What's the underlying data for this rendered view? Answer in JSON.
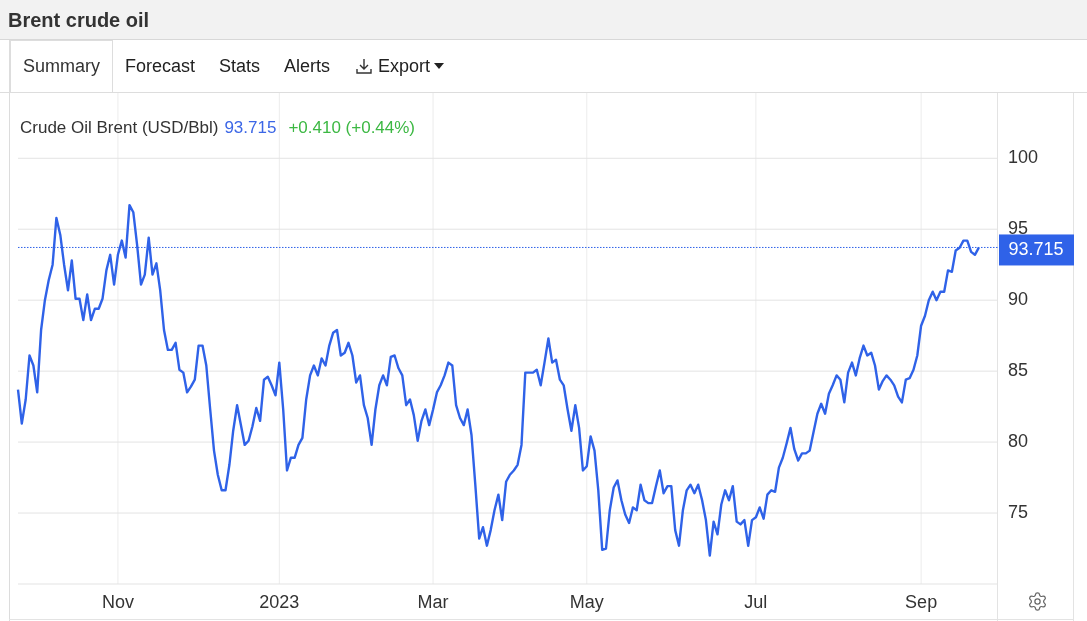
{
  "title": "Brent crude oil",
  "tabs": [
    {
      "label": "Summary",
      "kind": "tab",
      "selected": true
    },
    {
      "label": "Forecast",
      "kind": "tab",
      "selected": false
    },
    {
      "label": "Stats",
      "kind": "tab",
      "selected": false
    },
    {
      "label": "Alerts",
      "kind": "tab",
      "selected": false
    },
    {
      "label": "Export",
      "kind": "menu",
      "selected": false
    }
  ],
  "legend": {
    "price": "93.715",
    "change": "+0.410 (+0.44%)"
  },
  "chart": {
    "chart_data": {
      "type": "line",
      "categories": [
        null,
        null,
        null,
        null,
        null,
        null,
        null,
        null,
        null,
        null,
        null,
        null,
        null,
        null,
        null,
        null,
        null,
        null,
        null,
        null,
        null,
        null,
        null,
        null,
        null,
        null,
        "Nov",
        null,
        null,
        null,
        null,
        null,
        null,
        null,
        null,
        null,
        null,
        null,
        null,
        null,
        null,
        null,
        null,
        null,
        null,
        null,
        null,
        null,
        null,
        null,
        null,
        null,
        null,
        null,
        null,
        null,
        null,
        null,
        null,
        null,
        null,
        null,
        null,
        null,
        null,
        null,
        null,
        null,
        "2023",
        null,
        null,
        null,
        null,
        null,
        null,
        null,
        null,
        null,
        null,
        null,
        null,
        null,
        null,
        null,
        null,
        null,
        null,
        null,
        null,
        null,
        null,
        null,
        null,
        null,
        null,
        null,
        null,
        null,
        null,
        null,
        null,
        null,
        null,
        null,
        null,
        null,
        null,
        null,
        "Mar",
        null,
        null,
        null,
        null,
        null,
        null,
        null,
        null,
        null,
        null,
        null,
        null,
        null,
        null,
        null,
        null,
        null,
        null,
        null,
        null,
        null,
        null,
        null,
        null,
        null,
        null,
        null,
        null,
        null,
        null,
        null,
        null,
        null,
        null,
        null,
        null,
        null,
        null,
        null,
        "May",
        null,
        null,
        null,
        null,
        null,
        null,
        null,
        null,
        null,
        null,
        null,
        null,
        null,
        null,
        null,
        null,
        null,
        null,
        null,
        null,
        null,
        null,
        null,
        null,
        null,
        null,
        null,
        null,
        null,
        null,
        null,
        null,
        null,
        null,
        null,
        null,
        null,
        null,
        null,
        null,
        null,
        null,
        null,
        "Jul",
        null,
        null,
        null,
        null,
        null,
        null,
        null,
        null,
        null,
        null,
        null,
        null,
        null,
        null,
        null,
        null,
        null,
        null,
        null,
        null,
        null,
        null,
        null,
        null,
        null,
        null,
        null,
        null,
        null,
        null,
        null,
        null,
        null,
        null,
        null,
        null,
        null,
        null,
        null,
        null,
        null,
        null,
        "Sep",
        null,
        null,
        null,
        null,
        null,
        null,
        null,
        null,
        null,
        null,
        null,
        null,
        null,
        null,
        null
      ],
      "series": [
        {
          "name": "Crude Oil Brent (USD/Bbl)",
          "color": "#2f62e8",
          "values": [
            83.7,
            81.3,
            83.0,
            86.1,
            85.4,
            83.5,
            87.9,
            90.0,
            91.4,
            92.5,
            95.8,
            94.6,
            92.5,
            90.7,
            92.8,
            90.1,
            90.1,
            88.6,
            90.4,
            88.6,
            89.4,
            89.4,
            90.1,
            92.1,
            93.2,
            91.1,
            93.2,
            94.2,
            93.0,
            96.7,
            96.2,
            93.9,
            91.1,
            91.8,
            94.4,
            91.8,
            92.6,
            90.7,
            87.9,
            86.5,
            86.5,
            87.0,
            85.1,
            84.9,
            83.5,
            83.9,
            84.4,
            86.8,
            86.8,
            85.4,
            82.3,
            79.4,
            77.7,
            76.6,
            76.6,
            78.4,
            80.8,
            82.6,
            81.2,
            79.8,
            80.1,
            81.1,
            82.4,
            81.5,
            84.4,
            84.6,
            84.0,
            83.3,
            85.6,
            82.3,
            78.0,
            78.9,
            78.9,
            79.8,
            80.3,
            83.0,
            84.7,
            85.4,
            84.7,
            85.9,
            85.4,
            86.8,
            87.7,
            87.9,
            86.1,
            86.3,
            87.0,
            86.1,
            84.2,
            84.7,
            82.6,
            81.7,
            79.8,
            82.3,
            84.0,
            84.7,
            84.0,
            86.0,
            86.1,
            85.2,
            84.7,
            82.6,
            83.0,
            81.9,
            80.1,
            81.5,
            82.3,
            81.2,
            82.3,
            83.5,
            84.0,
            84.7,
            85.6,
            85.4,
            82.6,
            81.7,
            81.2,
            82.3,
            80.5,
            77.0,
            73.2,
            74.0,
            72.7,
            73.8,
            75.2,
            76.3,
            74.5,
            77.2,
            77.7,
            78.0,
            78.4,
            79.8,
            84.9,
            84.9,
            84.9,
            85.1,
            84.0,
            85.6,
            87.3,
            85.6,
            85.8,
            84.4,
            84.0,
            82.3,
            80.8,
            82.6,
            81.0,
            78.0,
            78.3,
            80.4,
            79.4,
            76.6,
            72.4,
            72.5,
            75.2,
            76.8,
            77.3,
            75.9,
            74.9,
            74.3,
            75.4,
            75.2,
            77.0,
            75.9,
            75.7,
            75.7,
            76.9,
            78.0,
            76.4,
            76.9,
            76.9,
            73.8,
            72.7,
            75.2,
            76.6,
            77.0,
            76.4,
            77.0,
            75.9,
            74.5,
            72.0,
            74.4,
            73.5,
            75.6,
            76.6,
            75.9,
            76.9,
            74.4,
            74.2,
            74.5,
            72.7,
            74.5,
            74.7,
            75.4,
            74.6,
            76.3,
            76.6,
            76.5,
            78.2,
            78.9,
            79.9,
            81.0,
            79.5,
            78.7,
            79.2,
            79.2,
            79.4,
            80.7,
            82.0,
            82.7,
            82.0,
            83.4,
            84.0,
            84.7,
            84.4,
            82.8,
            84.9,
            85.6,
            84.7,
            85.9,
            86.8,
            86.1,
            86.3,
            85.4,
            83.7,
            84.3,
            84.7,
            84.4,
            84.0,
            83.2,
            82.8,
            84.4,
            84.5,
            85.1,
            86.1,
            88.2,
            88.9,
            90.0,
            90.6,
            90.0,
            90.6,
            90.6,
            92.1,
            92.0,
            93.5,
            93.7,
            94.2,
            94.2,
            93.4,
            93.2,
            93.7
          ]
        }
      ],
      "ylim": [
        70,
        104.6
      ],
      "yticks": [
        75,
        80,
        85,
        90,
        95,
        100
      ],
      "grid": true,
      "ref_lines": [
        {
          "axis": "y",
          "value": 93.715,
          "label": "93.715"
        }
      ]
    }
  }
}
